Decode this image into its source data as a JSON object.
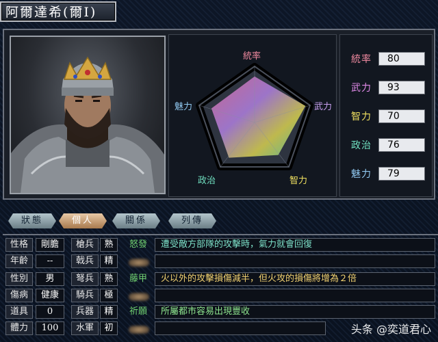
{
  "officer": {
    "name": "阿爾達希(爾Ⅰ)"
  },
  "radar": {
    "labels": {
      "tongshuai": "統率",
      "wuli": "武力",
      "zhili": "智力",
      "zhengzhi": "政治",
      "meili": "魅力"
    },
    "label_colors": {
      "tongshuai": "#f08aa0",
      "wuli": "#c9a0f0",
      "zhili": "#f0e060",
      "zhengzhi": "#70e0c0",
      "meili": "#90c8f0"
    }
  },
  "stats": [
    {
      "label": "統率",
      "value": "80",
      "color": "#f08aa0"
    },
    {
      "label": "武力",
      "value": "93",
      "color": "#e08ae8"
    },
    {
      "label": "智力",
      "value": "70",
      "color": "#f0e060"
    },
    {
      "label": "政治",
      "value": "76",
      "color": "#70e0c0"
    },
    {
      "label": "魅力",
      "value": "79",
      "color": "#90c8f0"
    }
  ],
  "tabs": [
    {
      "label": "狀態",
      "active": false
    },
    {
      "label": "個人",
      "active": true
    },
    {
      "label": "關係",
      "active": false
    },
    {
      "label": "列傳",
      "active": false
    }
  ],
  "personal": [
    {
      "label": "性格",
      "value": "剛膽"
    },
    {
      "label": "年齡",
      "value": "--"
    },
    {
      "label": "性別",
      "value": "男"
    },
    {
      "label": "傷病",
      "value": "健康"
    },
    {
      "label": "道具",
      "value": "0"
    },
    {
      "label": "體力",
      "value": "100"
    }
  ],
  "troops": [
    {
      "label": "槍兵",
      "value": "熟"
    },
    {
      "label": "戟兵",
      "value": "精"
    },
    {
      "label": "弩兵",
      "value": "熟"
    },
    {
      "label": "騎兵",
      "value": "極"
    },
    {
      "label": "兵器",
      "value": "精"
    },
    {
      "label": "水軍",
      "value": "初"
    }
  ],
  "skills": [
    {
      "name": "怒發",
      "desc": "遭受敵方部隊的攻擊時，氣力就會回復",
      "name_color": "#70d070",
      "desc_color": "#7de0c8"
    },
    {
      "name": "",
      "desc": "",
      "name_color": "",
      "desc_color": ""
    },
    {
      "name": "藤甲",
      "desc": "火以外的攻擊損傷減半，但火攻的損傷將增為２倍",
      "name_color": "#70d070",
      "desc_color": "#f0d070"
    },
    {
      "name": "",
      "desc": "",
      "name_color": "",
      "desc_color": ""
    },
    {
      "name": "祈願",
      "desc": "所屬都市容易出現豐收",
      "name_color": "#70d070",
      "desc_color": "#90e890"
    },
    {
      "name": "",
      "desc": "",
      "name_color": "",
      "desc_color": ""
    }
  ],
  "watermark": "头条 @奕道君心"
}
